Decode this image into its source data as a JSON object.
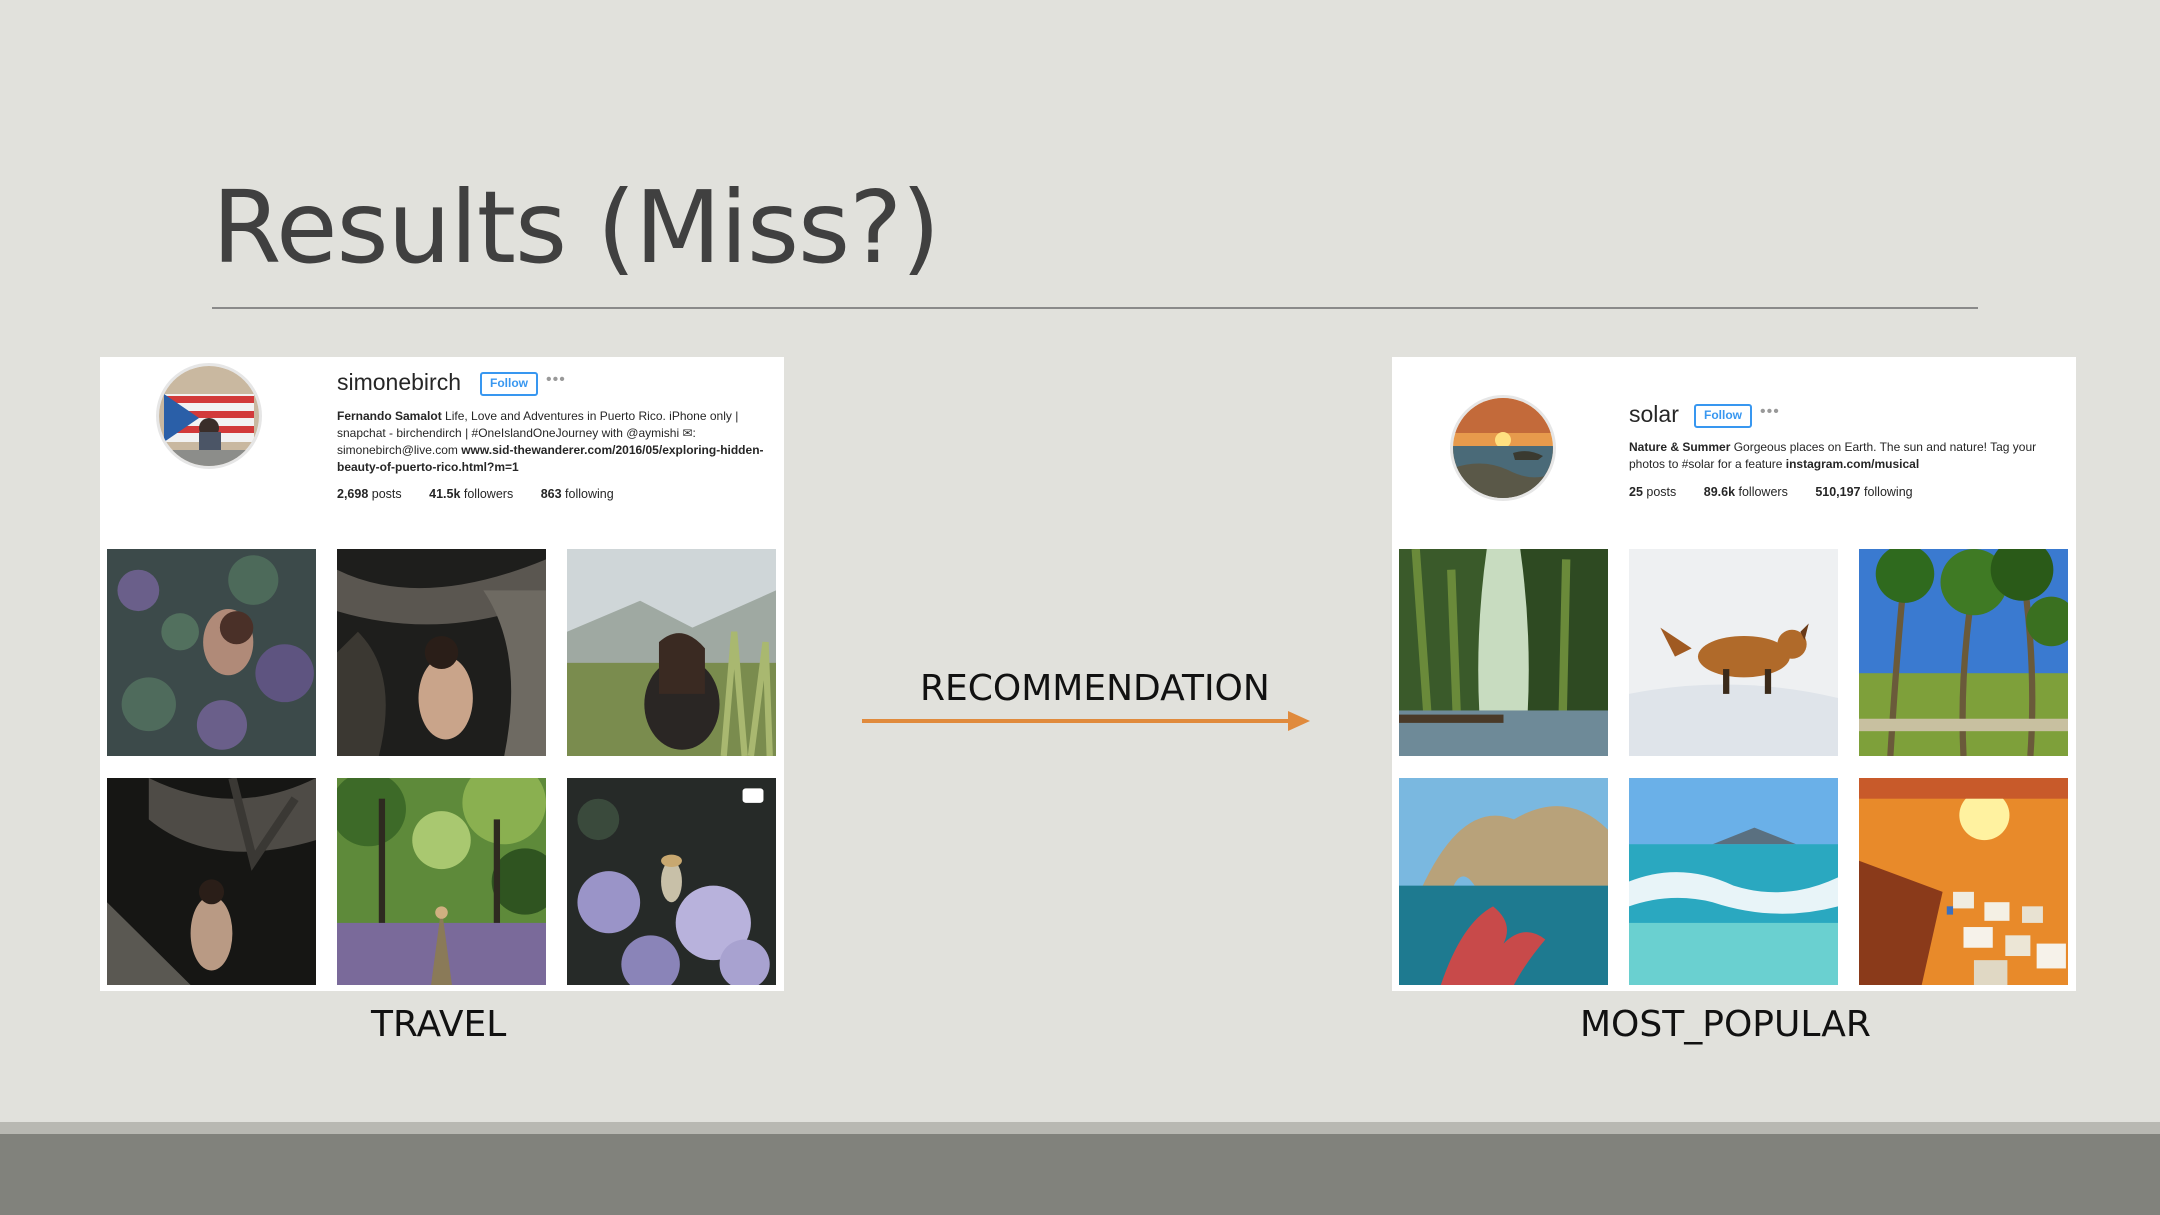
{
  "slide": {
    "title": "Results (Miss?)",
    "arrow_label": "RECOMMENDATION",
    "accent_color": "#e08a3c"
  },
  "left": {
    "caption": "TRAVEL",
    "username": "simonebirch",
    "follow_label": "Follow",
    "more": "•••",
    "bio_name": "Fernando Samalot",
    "bio_text": " Life, Love and Adventures in Puerto Rico. iPhone only | snapchat - birchendirch | #OneIslandOneJourney with @aymishi ✉: simonebirch@live.com ",
    "bio_link": "www.sid-thewanderer.com/2016/05/exploring-hidden-beauty-of-puerto-rico.html?m=1",
    "posts_num": "2,698",
    "posts_label": " posts",
    "followers_num": "41.5k",
    "followers_label": " followers",
    "following_num": "863",
    "following_label": " following"
  },
  "right": {
    "caption": "MOST_POPULAR",
    "username": "solar",
    "follow_label": "Follow",
    "more": "•••",
    "bio_name": "Nature & Summer",
    "bio_text": " Gorgeous places on Earth. The sun and nature! Tag your photos to #solar for a feature ",
    "bio_link": "instagram.com/musical",
    "posts_num": "25",
    "posts_label": " posts",
    "followers_num": "89.6k",
    "followers_label": " followers",
    "following_num": "510,197",
    "following_label": " following"
  }
}
